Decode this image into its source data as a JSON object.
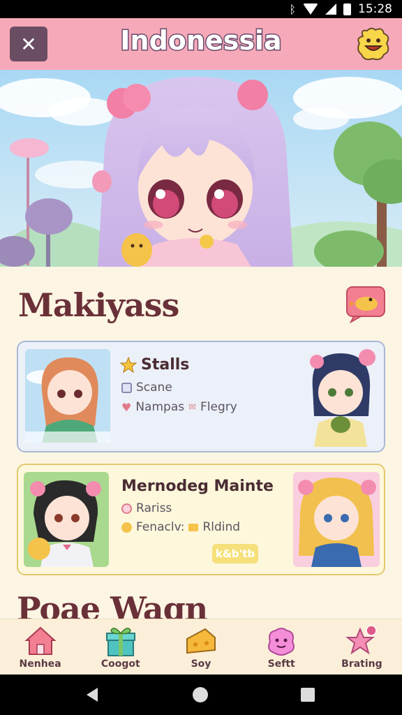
{
  "status_bar": {
    "time": "15:28",
    "bluetooth_icon": "ᛒ"
  },
  "header": {
    "title": "Indonessia",
    "close_icon": "✕",
    "mascot_icon": "smiling-mascot-icon"
  },
  "hero": {
    "image": "anime-girl-lavender-hair-pink-bows"
  },
  "section_1": {
    "title": "Makiyass",
    "chat_icon": "duck-chat-bubble-icon"
  },
  "cards": [
    {
      "title": "Stalls",
      "line1": "Scane",
      "line2_a": "Nampas",
      "line2_b": "Flegry",
      "left_avatar": "auburn-haired-girl-green-jacket",
      "right_avatar": "navy-haired-girl-pink-bows"
    },
    {
      "title": "Mernodeg Mainte",
      "line1": "Rariss",
      "line2_a": "Fenaclv:",
      "line2_b": "Rldind",
      "badge": "k&b'tb",
      "left_avatar": "dark-haired-girl-with-chick",
      "right_avatar": "blonde-girl-blue-dress"
    }
  ],
  "section_2": {
    "title": "Poae Wagn"
  },
  "bottom_nav": [
    {
      "label": "Nenhea",
      "icon": "house-icon"
    },
    {
      "label": "Coogot",
      "icon": "gift-box-icon"
    },
    {
      "label": "Soy",
      "icon": "cheese-icon"
    },
    {
      "label": "Seftt",
      "icon": "pink-blob-icon"
    },
    {
      "label": "Brating",
      "icon": "star-badge-icon"
    }
  ],
  "colors": {
    "header_bg": "#f6a9b8",
    "title_fill": "#ffffff",
    "title_outline": "#6b4a6e",
    "section_title": "#6a3038",
    "card1_bg": "#ecf0f8",
    "card2_bg": "#fdf7dc",
    "page_bg": "#fcf5e3"
  }
}
